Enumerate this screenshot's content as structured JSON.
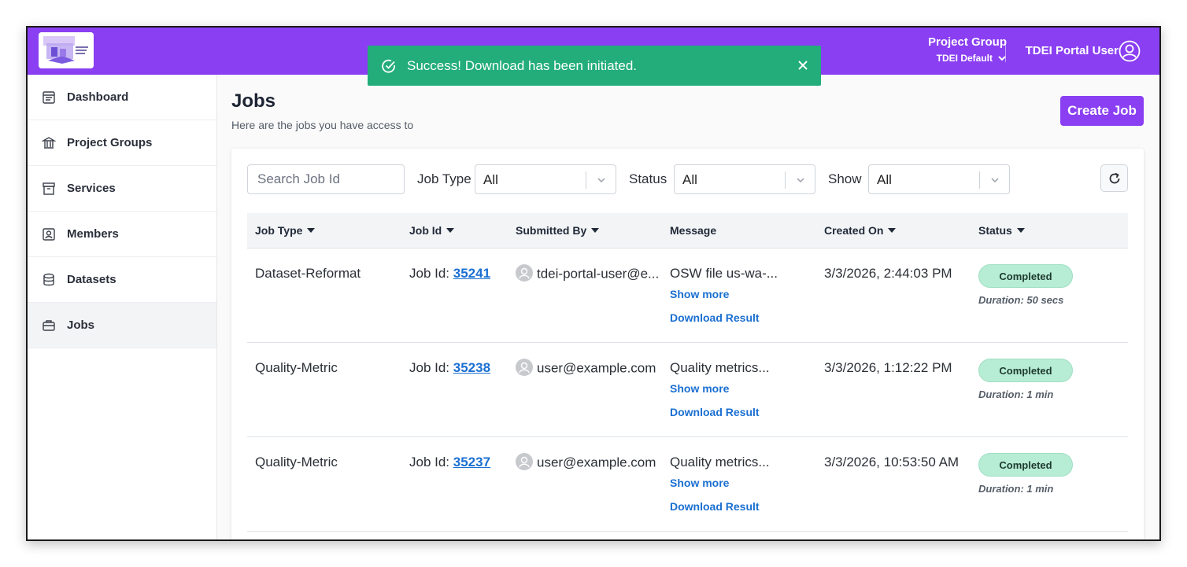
{
  "header": {
    "project_group_label": "Project Group",
    "project_group_value": "TDEI Default",
    "user_name": "TDEI Portal User"
  },
  "toast": {
    "message": "Success! Download has been initiated."
  },
  "sidebar": {
    "items": [
      {
        "label": "Dashboard",
        "icon": "dashboard-icon"
      },
      {
        "label": "Project Groups",
        "icon": "bank-icon"
      },
      {
        "label": "Services",
        "icon": "archive-icon"
      },
      {
        "label": "Members",
        "icon": "member-icon"
      },
      {
        "label": "Datasets",
        "icon": "database-icon"
      },
      {
        "label": "Jobs",
        "icon": "briefcase-icon",
        "active": true
      }
    ]
  },
  "page": {
    "title": "Jobs",
    "subtitle": "Here are the jobs you have access to",
    "create_button": "Create Job"
  },
  "filters": {
    "search_placeholder": "Search Job Id",
    "job_type_label": "Job Type",
    "job_type_value": "All",
    "status_label": "Status",
    "status_value": "All",
    "show_label": "Show",
    "show_value": "All"
  },
  "table": {
    "columns": [
      "Job Type",
      "Job Id",
      "Submitted By",
      "Message",
      "Created On",
      "Status"
    ],
    "rows": [
      {
        "job_type": "Dataset-Reformat",
        "job_id_prefix": "Job Id: ",
        "job_id": "35241",
        "submitted_by": "tdei-portal-user@e...",
        "message": "OSW file us-wa-...",
        "show_more": "Show more",
        "download": "Download Result",
        "created_on": "3/3/2026, 2:44:03 PM",
        "status": "Completed",
        "duration": "Duration: 50 secs"
      },
      {
        "job_type": "Quality-Metric",
        "job_id_prefix": "Job Id: ",
        "job_id": "35238",
        "submitted_by": "user@example.com",
        "message": "Quality metrics...",
        "show_more": "Show more",
        "download": "Download Result",
        "created_on": "3/3/2026, 1:12:22 PM",
        "status": "Completed",
        "duration": "Duration: 1 min"
      },
      {
        "job_type": "Quality-Metric",
        "job_id_prefix": "Job Id: ",
        "job_id": "35237",
        "submitted_by": "user@example.com",
        "message": "Quality metrics...",
        "show_more": "Show more",
        "download": "Download Result",
        "created_on": "3/3/2026, 10:53:50 AM",
        "status": "Completed",
        "duration": "Duration: 1 min"
      }
    ]
  },
  "colors": {
    "brand": "#8a3ff2",
    "toast": "#22ad7a",
    "link": "#1a6fd1",
    "badge": "#b7ecd5"
  }
}
